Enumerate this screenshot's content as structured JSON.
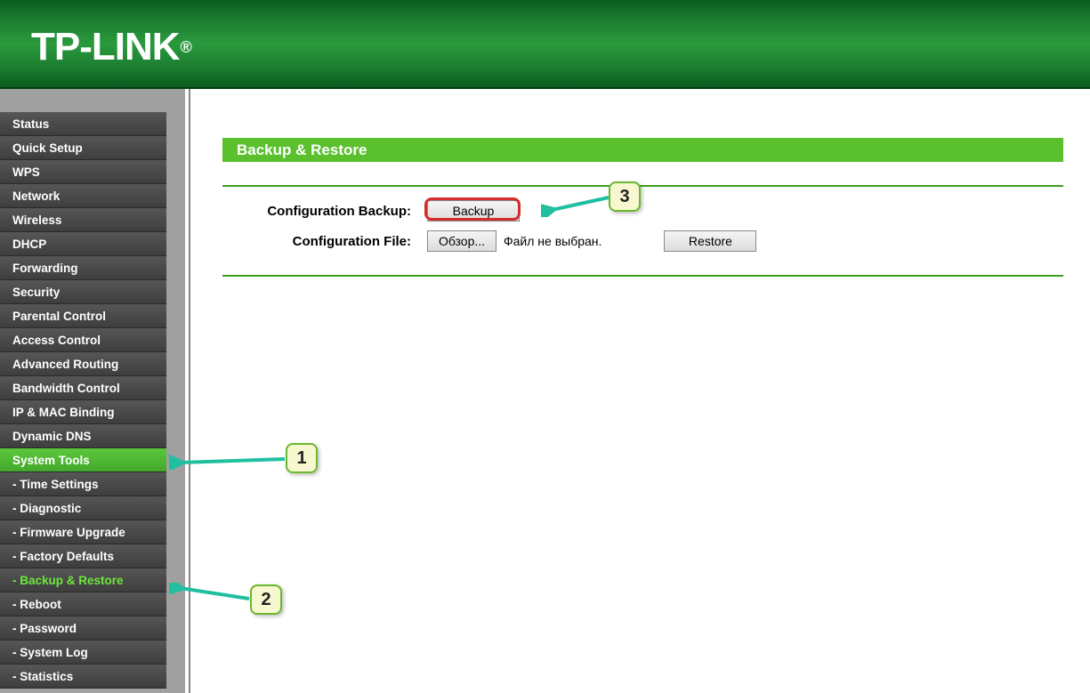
{
  "brand": "TP-LINK",
  "register": "®",
  "sidebar": {
    "items": [
      {
        "label": "Status"
      },
      {
        "label": "Quick Setup"
      },
      {
        "label": "WPS"
      },
      {
        "label": "Network"
      },
      {
        "label": "Wireless"
      },
      {
        "label": "DHCP"
      },
      {
        "label": "Forwarding"
      },
      {
        "label": "Security"
      },
      {
        "label": "Parental Control"
      },
      {
        "label": "Access Control"
      },
      {
        "label": "Advanced Routing"
      },
      {
        "label": "Bandwidth Control"
      },
      {
        "label": "IP & MAC Binding"
      },
      {
        "label": "Dynamic DNS"
      },
      {
        "label": "System Tools"
      },
      {
        "label": "- Time Settings"
      },
      {
        "label": "- Diagnostic"
      },
      {
        "label": "- Firmware Upgrade"
      },
      {
        "label": "- Factory Defaults"
      },
      {
        "label": "- Backup & Restore"
      },
      {
        "label": "- Reboot"
      },
      {
        "label": "- Password"
      },
      {
        "label": "- System Log"
      },
      {
        "label": "- Statistics"
      }
    ],
    "active_index": 14,
    "highlight_index": 19
  },
  "panel": {
    "title": "Backup & Restore",
    "row1_label": "Configuration Backup:",
    "backup_btn": "Backup",
    "row2_label": "Configuration File:",
    "browse_btn": "Обзор...",
    "file_status": "Файл не выбран.",
    "restore_btn": "Restore"
  },
  "callouts": {
    "c1": "1",
    "c2": "2",
    "c3": "3"
  }
}
